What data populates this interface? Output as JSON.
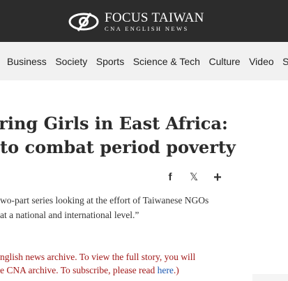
{
  "header": {
    "logo_title": "FOCUS TAIWAN",
    "logo_subtitle": "CNA ENGLISH NEWS",
    "logo_icon": "eye-logo-icon",
    "background": "#2c2c2c"
  },
  "nav": {
    "items": [
      "Business",
      "Society",
      "Sports",
      "Science & Tech",
      "Culture",
      "Video",
      "Sp"
    ]
  },
  "article": {
    "title_line1": "vering Girls in East Africa:",
    "title_line2": "to combat period poverty",
    "share_icons": [
      "facebook-icon",
      "x-icon",
      "plus-icon"
    ],
    "share_glyphs": [
      "f",
      "𝕏",
      "+"
    ],
    "lead_line1": "wo-part series looking at the effort of Taiwanese NGOs",
    "lead_line2": "at a national and international level.”",
    "notice_line1": "nglish news archive. To view the full story, you will",
    "notice_line2_prefix": "e CNA archive. To subscribe, please read ",
    "notice_link": "here",
    "notice_line2_suffix": ".)"
  }
}
